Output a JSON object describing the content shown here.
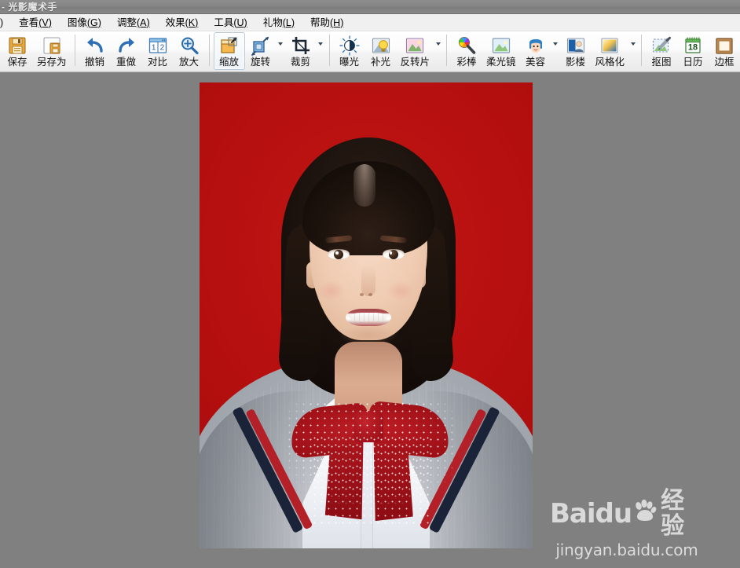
{
  "window": {
    "title": "- 光影魔术手",
    "bg_color": "#808080",
    "titlebar_color": "#848484"
  },
  "menubar": {
    "items": [
      {
        "name": "file",
        "label": ")",
        "accel": ""
      },
      {
        "name": "view",
        "label": "查看",
        "accel": "(V)"
      },
      {
        "name": "image",
        "label": "图像",
        "accel": "(G)"
      },
      {
        "name": "adjust",
        "label": "调整",
        "accel": "(A)"
      },
      {
        "name": "effects",
        "label": "效果",
        "accel": "(K)"
      },
      {
        "name": "tools",
        "label": "工具",
        "accel": "(U)"
      },
      {
        "name": "gifts",
        "label": "礼物",
        "accel": "(L)"
      },
      {
        "name": "help",
        "label": "帮助",
        "accel": "(H)"
      }
    ]
  },
  "toolbar": {
    "buttons": [
      {
        "name": "save",
        "label": "保存",
        "icon": "floppy-disk-icon",
        "dropdown": false,
        "selected": false
      },
      {
        "name": "save-as",
        "label": "另存为",
        "icon": "floppy-disk-save-as-icon",
        "dropdown": false,
        "selected": false
      },
      {
        "name": "undo",
        "label": "撤销",
        "icon": "undo-arrow-icon",
        "dropdown": false,
        "selected": false
      },
      {
        "name": "redo",
        "label": "重做",
        "icon": "redo-arrow-icon",
        "dropdown": false,
        "selected": false
      },
      {
        "name": "compare",
        "label": "对比",
        "icon": "compare-window-icon",
        "dropdown": false,
        "selected": false
      },
      {
        "name": "zoom-in",
        "label": "放大",
        "icon": "magnifier-plus-icon",
        "dropdown": false,
        "selected": false
      },
      {
        "name": "scale",
        "label": "缩放",
        "icon": "resize-icon",
        "dropdown": false,
        "selected": true
      },
      {
        "name": "rotate",
        "label": "旋转",
        "icon": "rotate-icon",
        "dropdown": true,
        "selected": false
      },
      {
        "name": "crop",
        "label": "裁剪",
        "icon": "crop-icon",
        "dropdown": true,
        "selected": false
      },
      {
        "name": "exposure",
        "label": "曝光",
        "icon": "exposure-icon",
        "dropdown": false,
        "selected": false
      },
      {
        "name": "fill-light",
        "label": "补光",
        "icon": "lightbulb-icon",
        "dropdown": false,
        "selected": false
      },
      {
        "name": "reversal-film",
        "label": "反转片",
        "icon": "landscape-photo-icon",
        "dropdown": true,
        "selected": false
      },
      {
        "name": "color-wand",
        "label": "彩棒",
        "icon": "color-wheel-wand-icon",
        "dropdown": false,
        "selected": false
      },
      {
        "name": "soft-focus",
        "label": "柔光镜",
        "icon": "soft-focus-icon",
        "dropdown": false,
        "selected": false
      },
      {
        "name": "beauty",
        "label": "美容",
        "icon": "face-beauty-icon",
        "dropdown": true,
        "selected": false
      },
      {
        "name": "photo-studio",
        "label": "影楼",
        "icon": "studio-portrait-icon",
        "dropdown": false,
        "selected": false
      },
      {
        "name": "stylize",
        "label": "风格化",
        "icon": "gradient-style-icon",
        "dropdown": true,
        "selected": false
      },
      {
        "name": "cutout",
        "label": "抠图",
        "icon": "cutout-pen-icon",
        "dropdown": false,
        "selected": false
      },
      {
        "name": "calendar",
        "label": "日历",
        "icon": "calendar-icon",
        "dropdown": false,
        "selected": false,
        "badge": "18"
      },
      {
        "name": "frame",
        "label": "边框",
        "icon": "picture-frame-icon",
        "dropdown": false,
        "selected": false
      }
    ]
  },
  "canvas": {
    "photo": {
      "name": "id-photo-preview",
      "subject": "young woman portrait",
      "background_color": "#b40f0f",
      "sweater_color": "#b9bdc3",
      "bowtie_color": "#ae161e",
      "shirt_color": "#ffffff"
    }
  },
  "watermark": {
    "brand_latin": "Baidu",
    "brand_cn": "经验",
    "url": "jingyan.baidu.com",
    "color": "#d9d9d9"
  }
}
